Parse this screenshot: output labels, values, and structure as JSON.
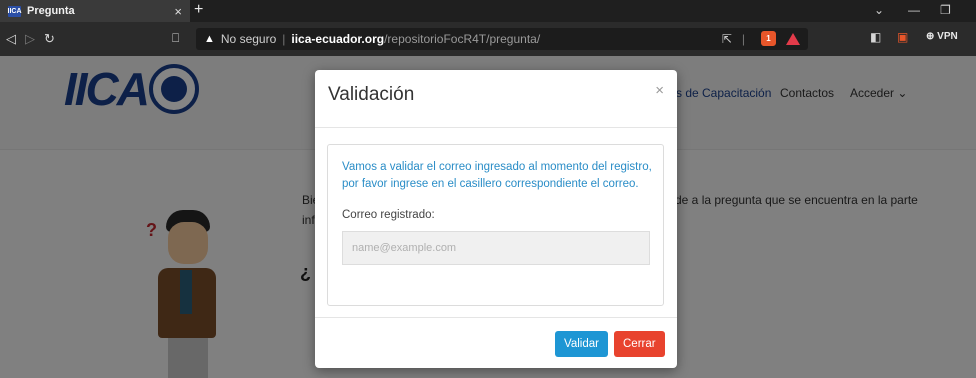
{
  "browser": {
    "tab_title": "Pregunta",
    "tab_favicon_text": "IICA",
    "insecure_label": "No seguro",
    "url_host": "iica-ecuador.org",
    "url_path": "/repositorioFocR4T/pregunta/",
    "vpn_label": "VPN",
    "brave_badge_count": "1"
  },
  "site": {
    "logo_text": "IICA",
    "nav": {
      "capacitacion": "s de Capacitación",
      "contactos": "Contactos",
      "acceder": "Acceder ⌄"
    },
    "intro_left_line1": "Bie",
    "intro_left_line2": "info",
    "intro_right": "de a la pregunta que se encuentra en la parte",
    "question_mark": "¿"
  },
  "modal": {
    "title": "Validación",
    "close_symbol": "×",
    "message": "Vamos a validar el correo ingresado al momento del registro, por favor ingrese en el casillero correspondiente el correo.",
    "field_label": "Correo registrado:",
    "email_placeholder": "name@example.com",
    "validate_label": "Validar",
    "close_label": "Cerrar"
  },
  "colors": {
    "validate_button": "#1e96d4",
    "close_button": "#e8432e",
    "message_text": "#2a8dc7",
    "brand_blue": "#1a3f8a"
  }
}
